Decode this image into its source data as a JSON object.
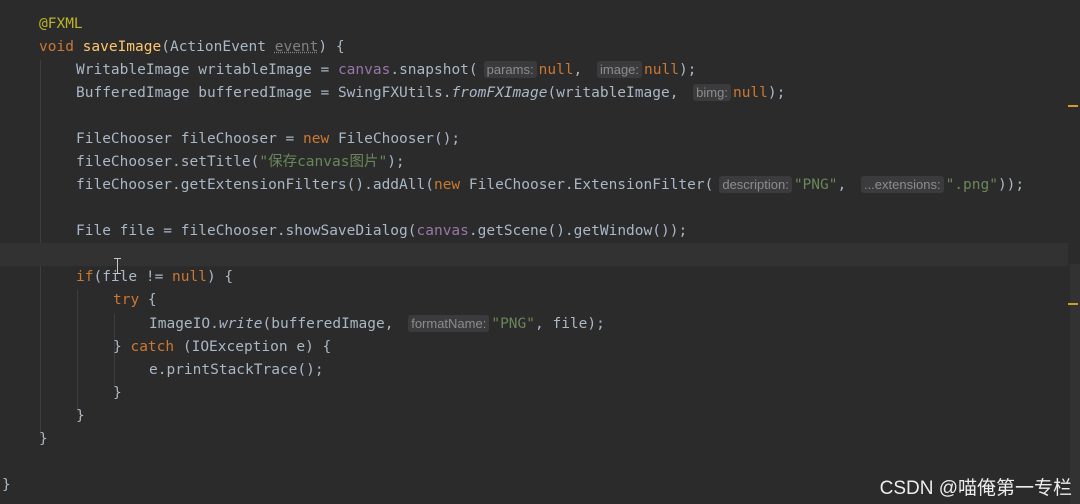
{
  "code": {
    "annotation": "@FXML",
    "method": {
      "modifier": "void",
      "name": "saveImage",
      "param_type": "ActionEvent",
      "param_name": "event"
    },
    "l3": {
      "type": "WritableImage",
      "var": "writableImage",
      "obj": "canvas",
      "call": "snapshot",
      "hint1": "params:",
      "hint2": "image:",
      "null": "null"
    },
    "l4": {
      "type": "BufferedImage",
      "var": "bufferedImage",
      "cls": "SwingFXUtils",
      "call": "fromFXImage",
      "arg": "writableImage",
      "hint": "bimg:",
      "null": "null"
    },
    "l6": {
      "type": "FileChooser",
      "var": "fileChooser",
      "new": "new",
      "ctor": "FileChooser"
    },
    "l7": {
      "target": "fileChooser",
      "call": "setTitle",
      "arg": "\"保存canvas图片\""
    },
    "l8": {
      "target": "fileChooser",
      "call": "getExtensionFilters",
      "call2": "addAll",
      "new": "new",
      "ctor": "FileChooser.ExtensionFilter",
      "hint1": "description:",
      "str1": "\"PNG\"",
      "hint2": "...extensions:",
      "str2": "\".png\""
    },
    "l10": {
      "type": "File",
      "var": "file",
      "target": "fileChooser",
      "call": "showSaveDialog",
      "obj": "canvas",
      "call2": "getScene",
      "call3": "getWindow"
    },
    "l12": {
      "kw": "if",
      "cond": "file",
      "null": "null"
    },
    "l13": {
      "kw": "try"
    },
    "l14": {
      "cls": "ImageIO",
      "call": "write",
      "arg1": "bufferedImage",
      "hint": "formatName:",
      "str": "\"PNG\"",
      "arg3": "file"
    },
    "l15": {
      "kw": "catch",
      "exc": "IOException",
      "var": "e"
    },
    "l16": {
      "target": "e",
      "call": "printStackTrace"
    }
  },
  "watermark": "CSDN @喵俺第一专栏",
  "colors": {
    "background": "#2b2b2b",
    "keyword": "#cc7832",
    "method_decl": "#ffc66d",
    "annotation": "#bbb529",
    "string": "#6a8759",
    "field": "#9876aa",
    "text": "#a9b7c6"
  }
}
